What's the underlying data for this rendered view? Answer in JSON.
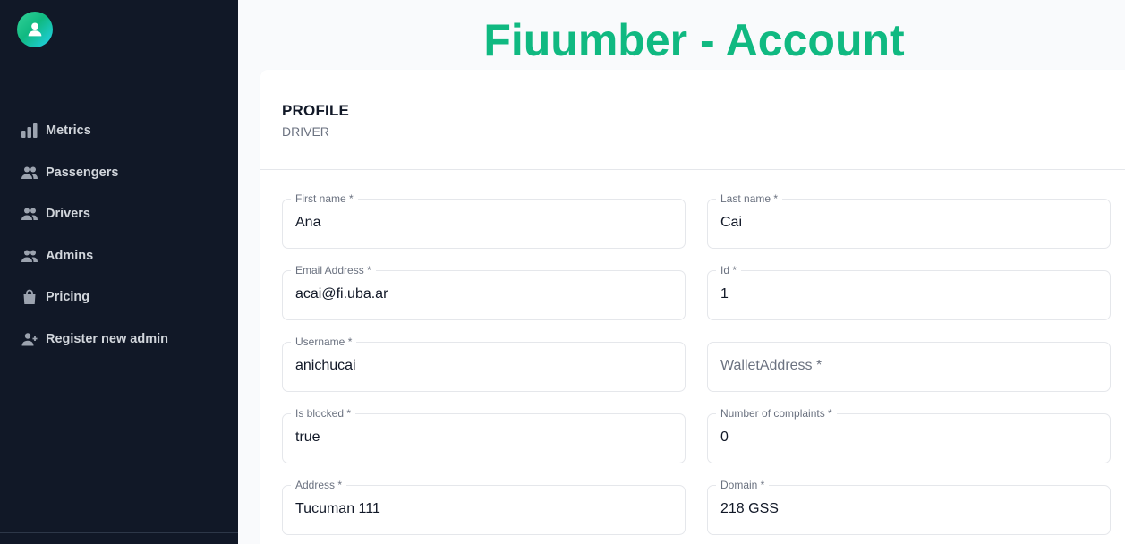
{
  "page": {
    "title": "Fiuumber - Account"
  },
  "sidebar": {
    "items": [
      {
        "label": "Metrics",
        "icon": "bar-chart-icon"
      },
      {
        "label": "Passengers",
        "icon": "users-icon"
      },
      {
        "label": "Drivers",
        "icon": "users-icon"
      },
      {
        "label": "Admins",
        "icon": "users-icon"
      },
      {
        "label": "Pricing",
        "icon": "shopping-bag-icon"
      },
      {
        "label": "Register new admin",
        "icon": "user-add-icon"
      }
    ]
  },
  "profile": {
    "title": "PROFILE",
    "subtitle": "DRIVER",
    "fields": {
      "first_name": {
        "label": "First name *",
        "value": "Ana"
      },
      "last_name": {
        "label": "Last name *",
        "value": "Cai"
      },
      "email": {
        "label": "Email Address *",
        "value": "acai@fi.uba.ar"
      },
      "id": {
        "label": "Id *",
        "value": "1"
      },
      "username": {
        "label": "Username *",
        "value": "anichucai"
      },
      "wallet_address": {
        "placeholder": "WalletAddress *",
        "value": ""
      },
      "is_blocked": {
        "label": "Is blocked *",
        "value": "true"
      },
      "complaints": {
        "label": "Number of complaints *",
        "value": "0"
      },
      "address": {
        "label": "Address *",
        "value": "Tucuman 111"
      },
      "domain": {
        "label": "Domain *",
        "value": "218 GSS"
      }
    }
  },
  "colors": {
    "sidebar_bg": "#111827",
    "accent": "#10b981",
    "page_bg": "#f9fafc"
  }
}
